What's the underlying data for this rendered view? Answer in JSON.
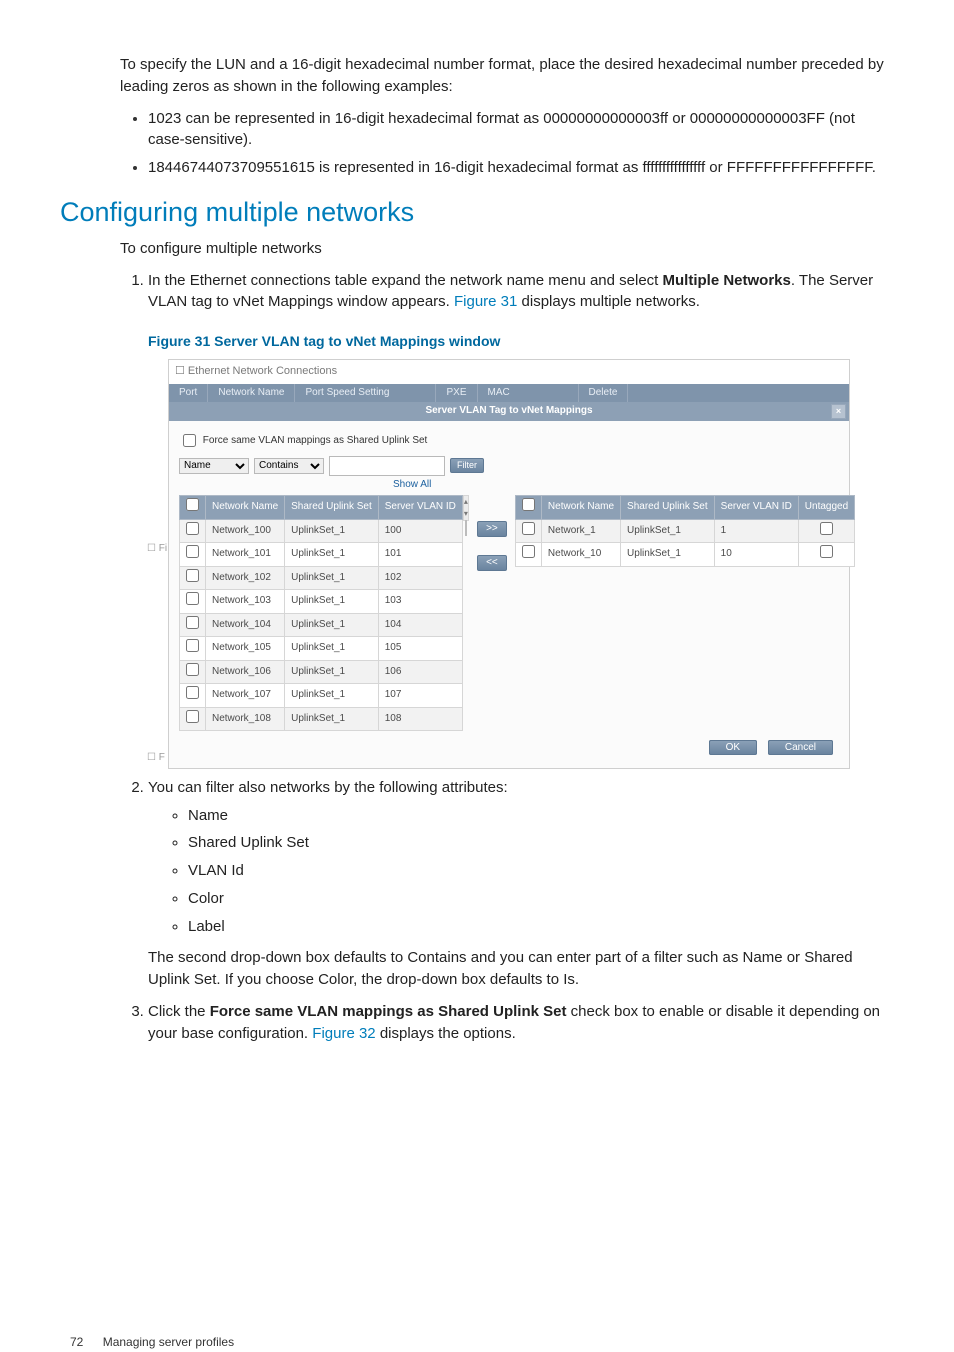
{
  "intro": {
    "p1": "To specify the LUN and a 16-digit hexadecimal number format, place the desired hexadecimal number preceded by leading zeros as shown in the following examples:",
    "li1": "1023 can be represented in 16-digit hexadecimal format as 00000000000003ff or 00000000000003FF (not case-sensitive).",
    "li2": "18446744073709551615 is represented in 16-digit hexadecimal format as ffffffffffffffff or FFFFFFFFFFFFFFFF."
  },
  "heading": "Configuring multiple networks",
  "step_intro": "To configure multiple networks",
  "steps": {
    "s1a": "In the Ethernet connections table expand the network name menu and select ",
    "s1b_bold": "Multiple Networks",
    "s1c": ". The Server VLAN tag to vNet Mappings window appears. ",
    "s1_link": "Figure 31",
    "s1d": " displays multiple networks.",
    "s2": "You can filter also networks by the following attributes:",
    "s2_items": [
      "Name",
      "Shared Uplink Set",
      "VLAN Id",
      "Color",
      "Label"
    ],
    "s2_tail": "The second drop-down box defaults to Contains and you can enter part of a filter such as Name or Shared Uplink Set. If you choose Color, the drop-down box defaults to Is.",
    "s3a": "Click the ",
    "s3b_bold": "Force same VLAN mappings as Shared Uplink Set",
    "s3c": " check box to enable or disable it depending on your base configuration. ",
    "s3_link": "Figure 32",
    "s3d": " displays the options."
  },
  "figcap": "Figure 31 Server VLAN tag to vNet Mappings window",
  "shot": {
    "title": "Ethernet Network Connections",
    "tabs": [
      "Port",
      "Network Name",
      "Port Speed Setting",
      "PXE",
      "MAC",
      "Delete"
    ],
    "subbar": "Server VLAN Tag to vNet Mappings",
    "force_label": "Force same VLAN mappings as Shared Uplink Set",
    "filter": {
      "attr_default": "Name",
      "op_default": "Contains",
      "btn": "Filter",
      "showall": "Show All"
    },
    "left": {
      "cols": [
        "",
        "Network Name",
        "Shared Uplink Set",
        "Server VLAN ID"
      ],
      "rows": [
        [
          "Network_100",
          "UplinkSet_1",
          "100"
        ],
        [
          "Network_101",
          "UplinkSet_1",
          "101"
        ],
        [
          "Network_102",
          "UplinkSet_1",
          "102"
        ],
        [
          "Network_103",
          "UplinkSet_1",
          "103"
        ],
        [
          "Network_104",
          "UplinkSet_1",
          "104"
        ],
        [
          "Network_105",
          "UplinkSet_1",
          "105"
        ],
        [
          "Network_106",
          "UplinkSet_1",
          "106"
        ],
        [
          "Network_107",
          "UplinkSet_1",
          "107"
        ],
        [
          "Network_108",
          "UplinkSet_1",
          "108"
        ]
      ]
    },
    "right": {
      "cols": [
        "",
        "Network Name",
        "Shared Uplink Set",
        "Server VLAN ID",
        "Untagged"
      ],
      "rows": [
        [
          "Network_1",
          "UplinkSet_1",
          "1"
        ],
        [
          "Network_10",
          "UplinkSet_1",
          "10"
        ]
      ]
    },
    "move_r": ">>",
    "move_l": "<<",
    "ok": "OK",
    "cancel": "Cancel"
  },
  "footer": {
    "page": "72",
    "section": "Managing server profiles"
  }
}
